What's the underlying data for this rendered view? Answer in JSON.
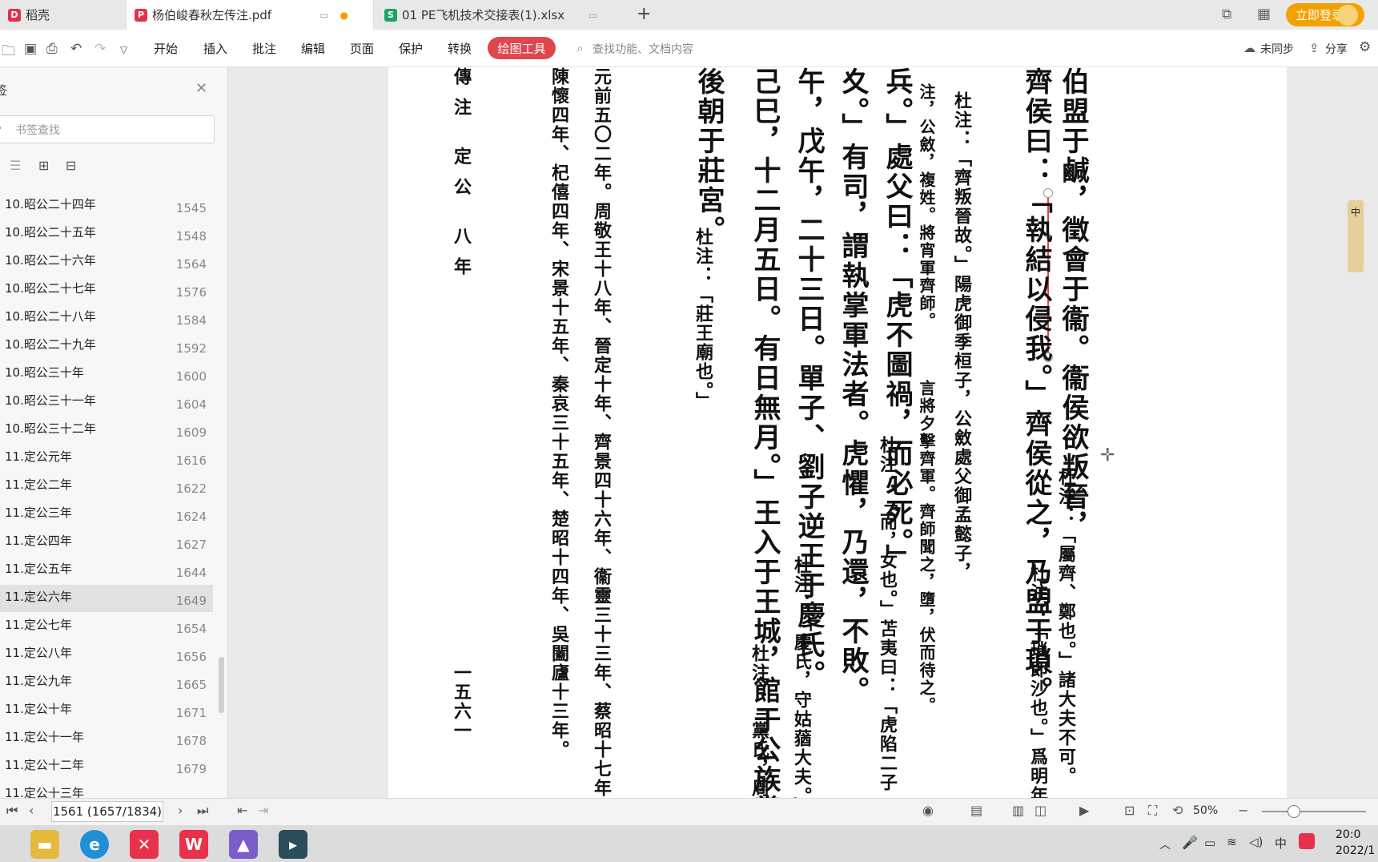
{
  "tabs": [
    {
      "label": "稻壳",
      "icon": "daoke-logo-icon"
    },
    {
      "label": "杨伯峻春秋左传注.pdf",
      "icon": "pdf-icon"
    },
    {
      "label": "01 PE飞机技术交接表(1).xlsx",
      "icon": "xlsx-icon"
    }
  ],
  "header": {
    "login": "立即登录",
    "new_tab": "+"
  },
  "toolbar": {
    "menus": [
      "开始",
      "插入",
      "批注",
      "编辑",
      "页面",
      "保护",
      "转换"
    ],
    "active_tool": "绘图工具",
    "search_placeholder": "查找功能、文档内容",
    "sync": "未同步",
    "share": "分享"
  },
  "sidebar": {
    "title": "签",
    "search_placeholder": "书签查找",
    "items": [
      {
        "label": "10.昭公二十四年",
        "page": "1545"
      },
      {
        "label": "10.昭公二十五年",
        "page": "1548"
      },
      {
        "label": "10.昭公二十六年",
        "page": "1564"
      },
      {
        "label": "10.昭公二十七年",
        "page": "1576"
      },
      {
        "label": "10.昭公二十八年",
        "page": "1584"
      },
      {
        "label": "10.昭公二十九年",
        "page": "1592"
      },
      {
        "label": "10.昭公三十年",
        "page": "1600"
      },
      {
        "label": "10.昭公三十一年",
        "page": "1604"
      },
      {
        "label": "10.昭公三十二年",
        "page": "1609"
      },
      {
        "label": "11.定公元年",
        "page": "1616"
      },
      {
        "label": "11.定公二年",
        "page": "1622"
      },
      {
        "label": "11.定公三年",
        "page": "1624"
      },
      {
        "label": "11.定公四年",
        "page": "1627"
      },
      {
        "label": "11.定公五年",
        "page": "1644"
      },
      {
        "label": "11.定公六年",
        "page": "1649"
      },
      {
        "label": "11.定公七年",
        "page": "1654"
      },
      {
        "label": "11.定公八年",
        "page": "1656"
      },
      {
        "label": "11.定公九年",
        "page": "1665"
      },
      {
        "label": "11.定公十年",
        "page": "1671"
      },
      {
        "label": "11.定公十一年",
        "page": "1678"
      },
      {
        "label": "11.定公十二年",
        "page": "1679"
      },
      {
        "label": "11.定公十三年",
        "page": ""
      }
    ]
  },
  "document": {
    "header_text": "傳注 定公 八年",
    "page_number": "一五六一",
    "columns": [
      {
        "text": "伯盟于鹹，徵會于衞。衞侯欲叛晉，",
        "size": "big"
      },
      {
        "text": "杜注：「屬齊、鄭也。」諸大夫不可。",
        "size": "sm"
      },
      {
        "text": "齊侯曰：「執結以侵我。」齊侯從之，乃盟于瑣。",
        "size": "big"
      },
      {
        "text": "杜注：「瑣即沙也。」爲明年",
        "size": "sm"
      },
      {
        "text": "杜注：「齊叛晉故。」陽虎御季桓子，公斂處父御孟懿子，",
        "size": "sm"
      },
      {
        "text": "注，公斂，複姓。將宵軍齊師。",
        "size": "xs"
      },
      {
        "text": "兵。」處父曰：「虎不圖禍，而必死。」",
        "size": "big"
      },
      {
        "text": "杜注：「而，女也。」苫夷曰：「虎陷二子",
        "size": "sm"
      },
      {
        "text": "言將夕擊齊軍。齊師聞之，墮，伏而待之。",
        "size": "xs"
      },
      {
        "text": "夊。」有司，謂執掌軍法者。虎懼，乃還，不敗。",
        "size": "big"
      },
      {
        "text": "午，戊午，二十三日。單子、劉子逆王于慶氏。",
        "size": "big"
      },
      {
        "text": "杜注：「慶氏，守姑蕕大夫。」",
        "size": "sm"
      },
      {
        "text": "己巳，十二月五日。有日無月。」王入于王城，館于公族黨氏，",
        "size": "big"
      },
      {
        "text": "杜注：「黨氏，周",
        "size": "sm"
      },
      {
        "text": "後朝于莊宮。",
        "size": "big"
      },
      {
        "text": "杜注：「莊王廟也。」",
        "size": "sm"
      },
      {
        "text": "元前五〇二年。周敬王十八年、晉定十年、齊景四十六年、衞靈三十三年、蔡昭十七年、",
        "size": "sm"
      },
      {
        "text": "陳懷四年、杞僖四年、宋景十五年、秦哀三十五年、楚昭十四年、吳闔廬十三年。",
        "size": "sm"
      }
    ]
  },
  "statusbar": {
    "page_field": "1561 (1657/1834)",
    "zoom": "50%"
  },
  "float_panel": {
    "label": "中"
  },
  "taskbar": {
    "apps": [
      "file-explorer-icon",
      "edge-icon",
      "xmind-icon",
      "wps-icon",
      "photos-icon",
      "terminal-icon"
    ],
    "tray_ime": "中",
    "time": "20:0",
    "date": "2022/1"
  },
  "colors": {
    "accent_red": "#e0474c",
    "login_orange": "#f2a100",
    "xlsx_green": "#1fa463",
    "pdf_red": "#e2334a"
  }
}
